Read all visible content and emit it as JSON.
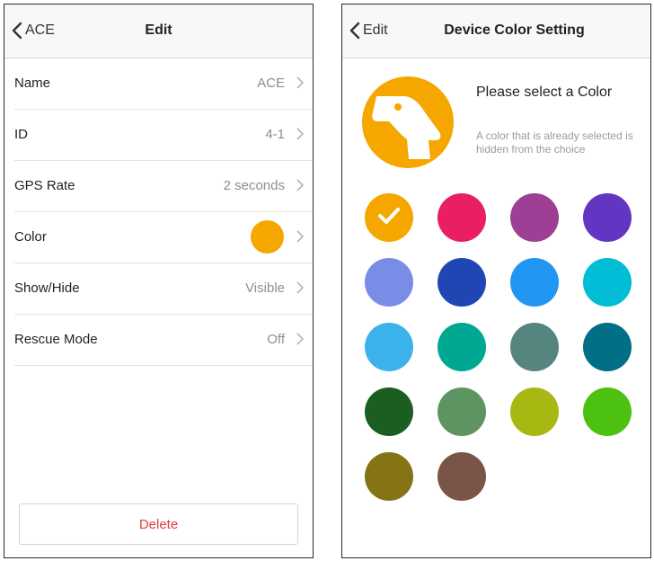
{
  "edit_screen": {
    "back_label": "ACE",
    "title": "Edit",
    "rows": [
      {
        "label": "Name",
        "value": "ACE"
      },
      {
        "label": "ID",
        "value": "4-1"
      },
      {
        "label": "GPS Rate",
        "value": "2 seconds"
      },
      {
        "label": "Color",
        "value": ""
      },
      {
        "label": "Show/Hide",
        "value": "Visible"
      },
      {
        "label": "Rescue Mode",
        "value": "Off"
      }
    ],
    "selected_color": "#f5a700",
    "delete_label": "Delete"
  },
  "color_screen": {
    "back_label": "Edit",
    "title": "Device Color Setting",
    "prompt_title": "Please select a Color",
    "prompt_subtitle": "A color that is already selected is hidden from the choice",
    "avatar_color": "#f5a700",
    "avatar_icon": "dog-head-icon",
    "selected_index": 0,
    "swatches": [
      "#f5a700",
      "#e91e63",
      "#9c3f95",
      "#6236c2",
      "#7a8de6",
      "#1f46b2",
      "#2196f3",
      "#00bcd4",
      "#3bb3ea",
      "#00a894",
      "#568580",
      "#006e85",
      "#1b5e20",
      "#5e9462",
      "#a8b813",
      "#4cc110",
      "#857414",
      "#7a5447"
    ]
  }
}
